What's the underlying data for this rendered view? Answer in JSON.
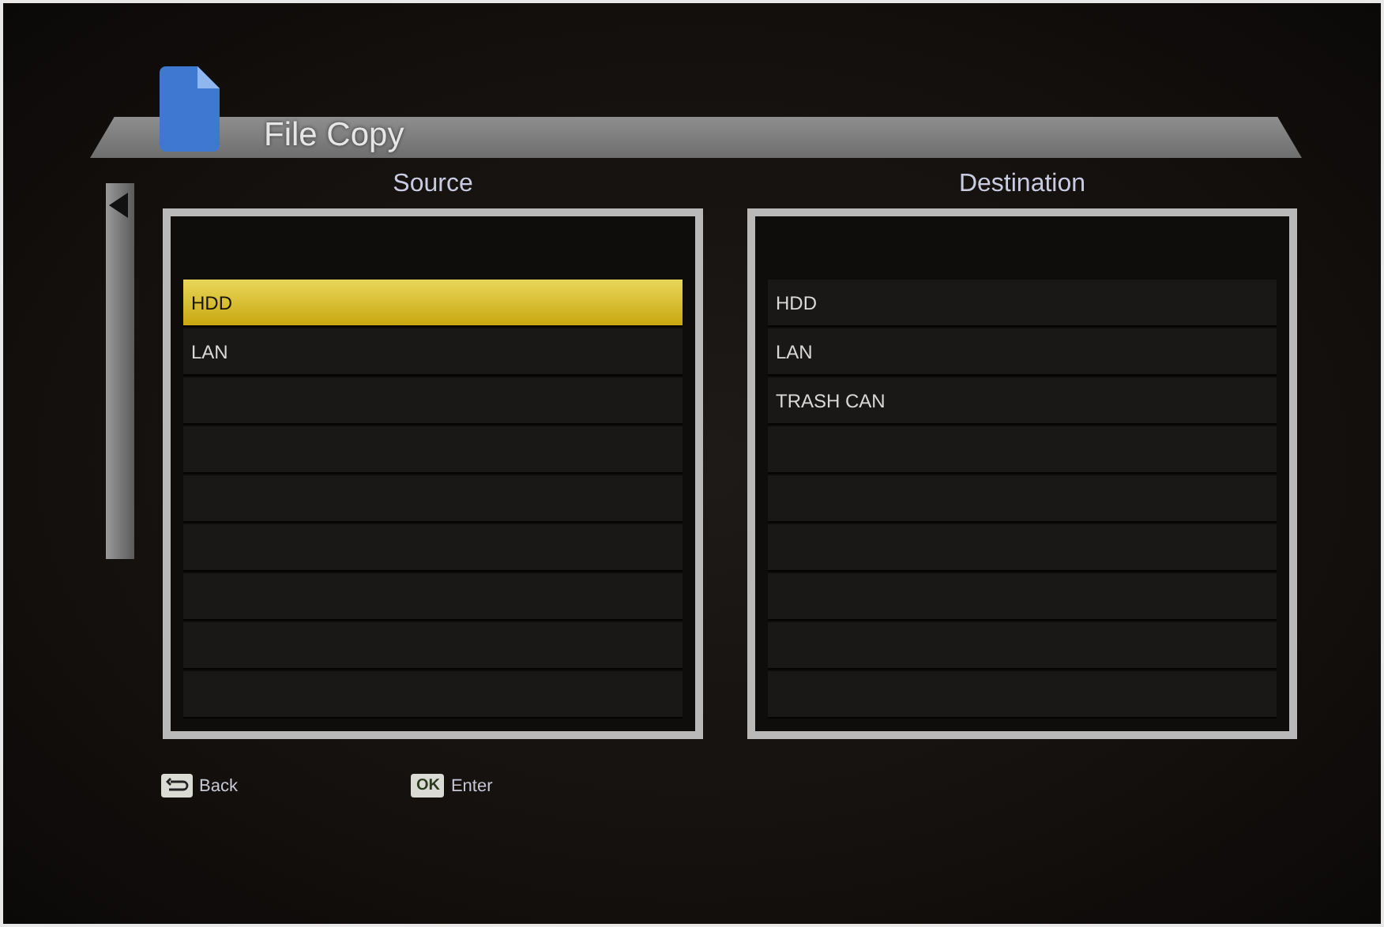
{
  "window": {
    "title": "File Copy"
  },
  "panels": [
    {
      "heading": "Source",
      "items": [
        {
          "label": "HDD",
          "selected": true
        },
        {
          "label": "LAN",
          "selected": false
        }
      ]
    },
    {
      "heading": "Destination",
      "items": [
        {
          "label": "HDD",
          "selected": false
        },
        {
          "label": "LAN",
          "selected": false
        },
        {
          "label": "TRASH CAN",
          "selected": false
        }
      ]
    }
  ],
  "hints": [
    {
      "kind": "back",
      "label": "Back"
    },
    {
      "kind": "ok",
      "key": "OK",
      "label": "Enter"
    }
  ]
}
